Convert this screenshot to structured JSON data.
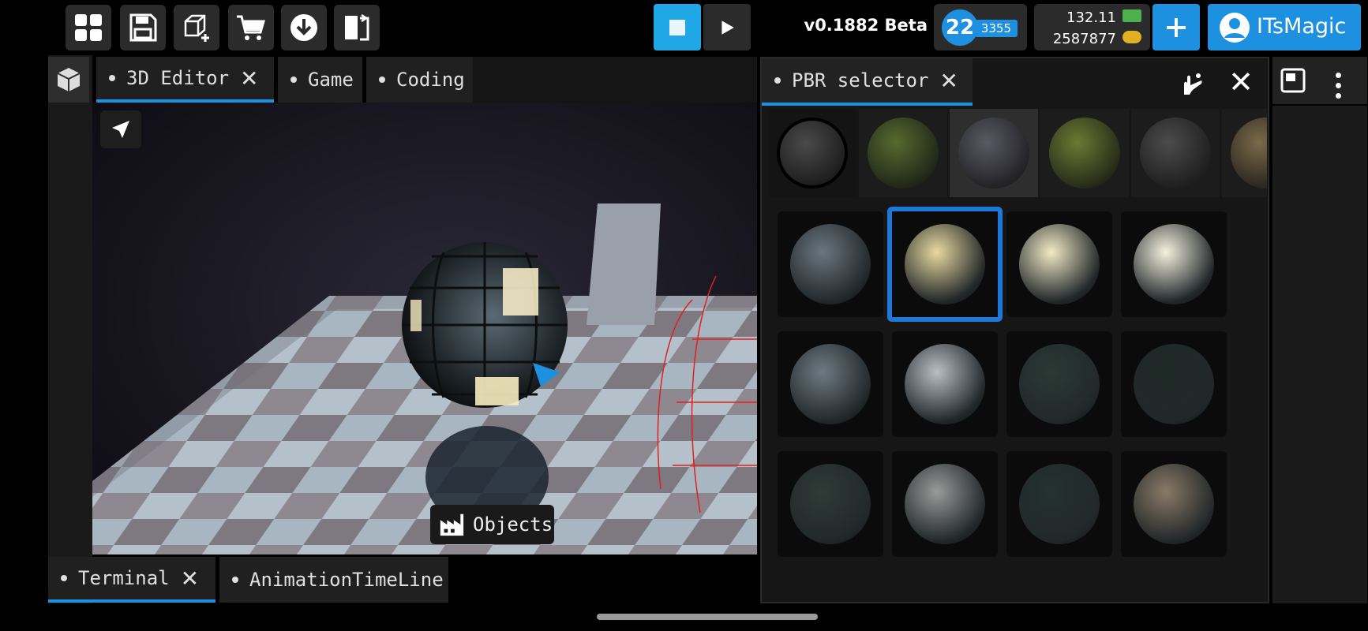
{
  "toolbar": {
    "buttons": [
      "apps-icon",
      "save-icon",
      "new-cube-icon",
      "cart-icon",
      "download-icon",
      "export-icon"
    ]
  },
  "playback": {
    "stop_icon": "stop-icon",
    "play_icon": "play-icon",
    "accent": "#1fa7e6"
  },
  "version": "v0.1882 Beta",
  "level": {
    "number": "22",
    "xp": "3355"
  },
  "currency": {
    "money": "132.11",
    "coins": "2587877"
  },
  "account": {
    "plus_icon": "plus-icon",
    "name": "ITsMagic",
    "accent": "#1e90e0"
  },
  "editor_tabs": [
    {
      "label": "3D Editor",
      "active": true,
      "closable": true
    },
    {
      "label": "Game"
    },
    {
      "label": "Coding"
    }
  ],
  "viewport": {
    "objects_label": "Objects",
    "floating_tool": "select-arrow-icon"
  },
  "bottom_tabs": [
    {
      "label": "Terminal",
      "active": true,
      "closable": true
    },
    {
      "label": "AnimationTimeLine"
    }
  ],
  "pbr_panel": {
    "title": "PBR selector",
    "top_swatches": [
      "#4a4a4a",
      "#556b2f",
      "#5a5a66",
      "#6b7a33",
      "#4c4c4c",
      "#7a6a4a"
    ],
    "grid": [
      [
        "#6a7680",
        "#e8d9a0",
        "#f1eac6",
        "#f5f1e0"
      ],
      [
        "#6e7a83",
        "#b8bec4",
        "#2a3a34",
        "#1e2a26"
      ],
      [
        "#2e3b36",
        "#9a9a9a",
        "#24322e",
        "#8a7a66"
      ]
    ],
    "selected_index": 1
  }
}
